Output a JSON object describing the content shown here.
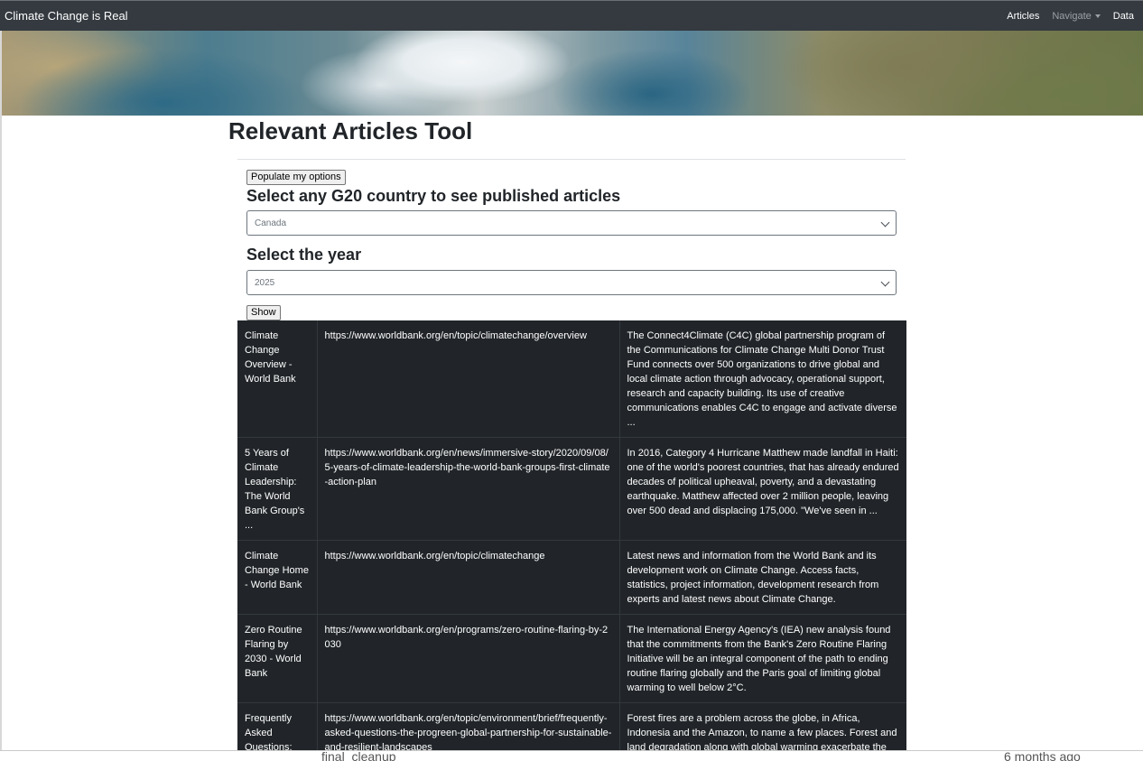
{
  "navbar": {
    "brand": "Climate Change is Real",
    "links": [
      {
        "label": "Articles"
      },
      {
        "label": "Navigate"
      },
      {
        "label": "Data"
      }
    ]
  },
  "main": {
    "title": "Relevant Articles Tool",
    "populate_button": "Populate my options",
    "country_label": "Select any G20 country to see published articles",
    "country_value": "Canada",
    "year_label": "Select the year",
    "year_value": "2025",
    "show_button": "Show"
  },
  "articles": [
    {
      "title": "Climate Change Overview - World Bank",
      "url": "https://www.worldbank.org/en/topic/climatechange/overview",
      "description": "The Connect4Climate (C4C) global partnership program of the Communications for Climate Change Multi Donor Trust Fund connects over 500 organizations to drive global and local climate action through advocacy, operational support, research and capacity building. Its use of creative communications enables C4C to engage and activate diverse ..."
    },
    {
      "title": "5 Years of Climate Leadership: The World Bank Group's ...",
      "url": "https://www.worldbank.org/en/news/immersive-story/2020/09/08/5-years-of-climate-leadership-the-world-bank-groups-first-climate-action-plan",
      "description": "In 2016, Category 4 Hurricane Matthew made landfall in Haiti: one of the world's poorest countries, that has already endured decades of political upheaval, poverty, and a devastating earthquake. Matthew affected over 2 million people, leaving over 500 dead and displacing 175,000. \"We've seen in ..."
    },
    {
      "title": "Climate Change Home - World Bank",
      "url": "https://www.worldbank.org/en/topic/climatechange",
      "description": "Latest news and information from the World Bank and its development work on Climate Change. Access facts, statistics, project information, development research from experts and latest news about Climate Change."
    },
    {
      "title": "Zero Routine Flaring by 2030 - World Bank",
      "url": "https://www.worldbank.org/en/programs/zero-routine-flaring-by-2030",
      "description": "The International Energy Agency's (IEA) new analysis found that the commitments from the Bank's Zero Routine Flaring Initiative will be an integral component of the path to ending routine flaring globally and the Paris goal of limiting global warming to well below 2°C."
    },
    {
      "title": "Frequently Asked Questions: The PROGREEN",
      "url": "https://www.worldbank.org/en/topic/environment/brief/frequently-asked-questions-the-progreen-global-partnership-for-sustainable-and-resilient-landscapes",
      "description": "Forest fires are a problem across the globe, in Africa, Indonesia and the Amazon, to name a few places. Forest and land degradation along with global warming exacerbate the risks from fires. PROGREEN will develop innovative fire management"
    }
  ],
  "background_window": {
    "left_text": "final_cleanup",
    "right_text": "6 months ago"
  }
}
